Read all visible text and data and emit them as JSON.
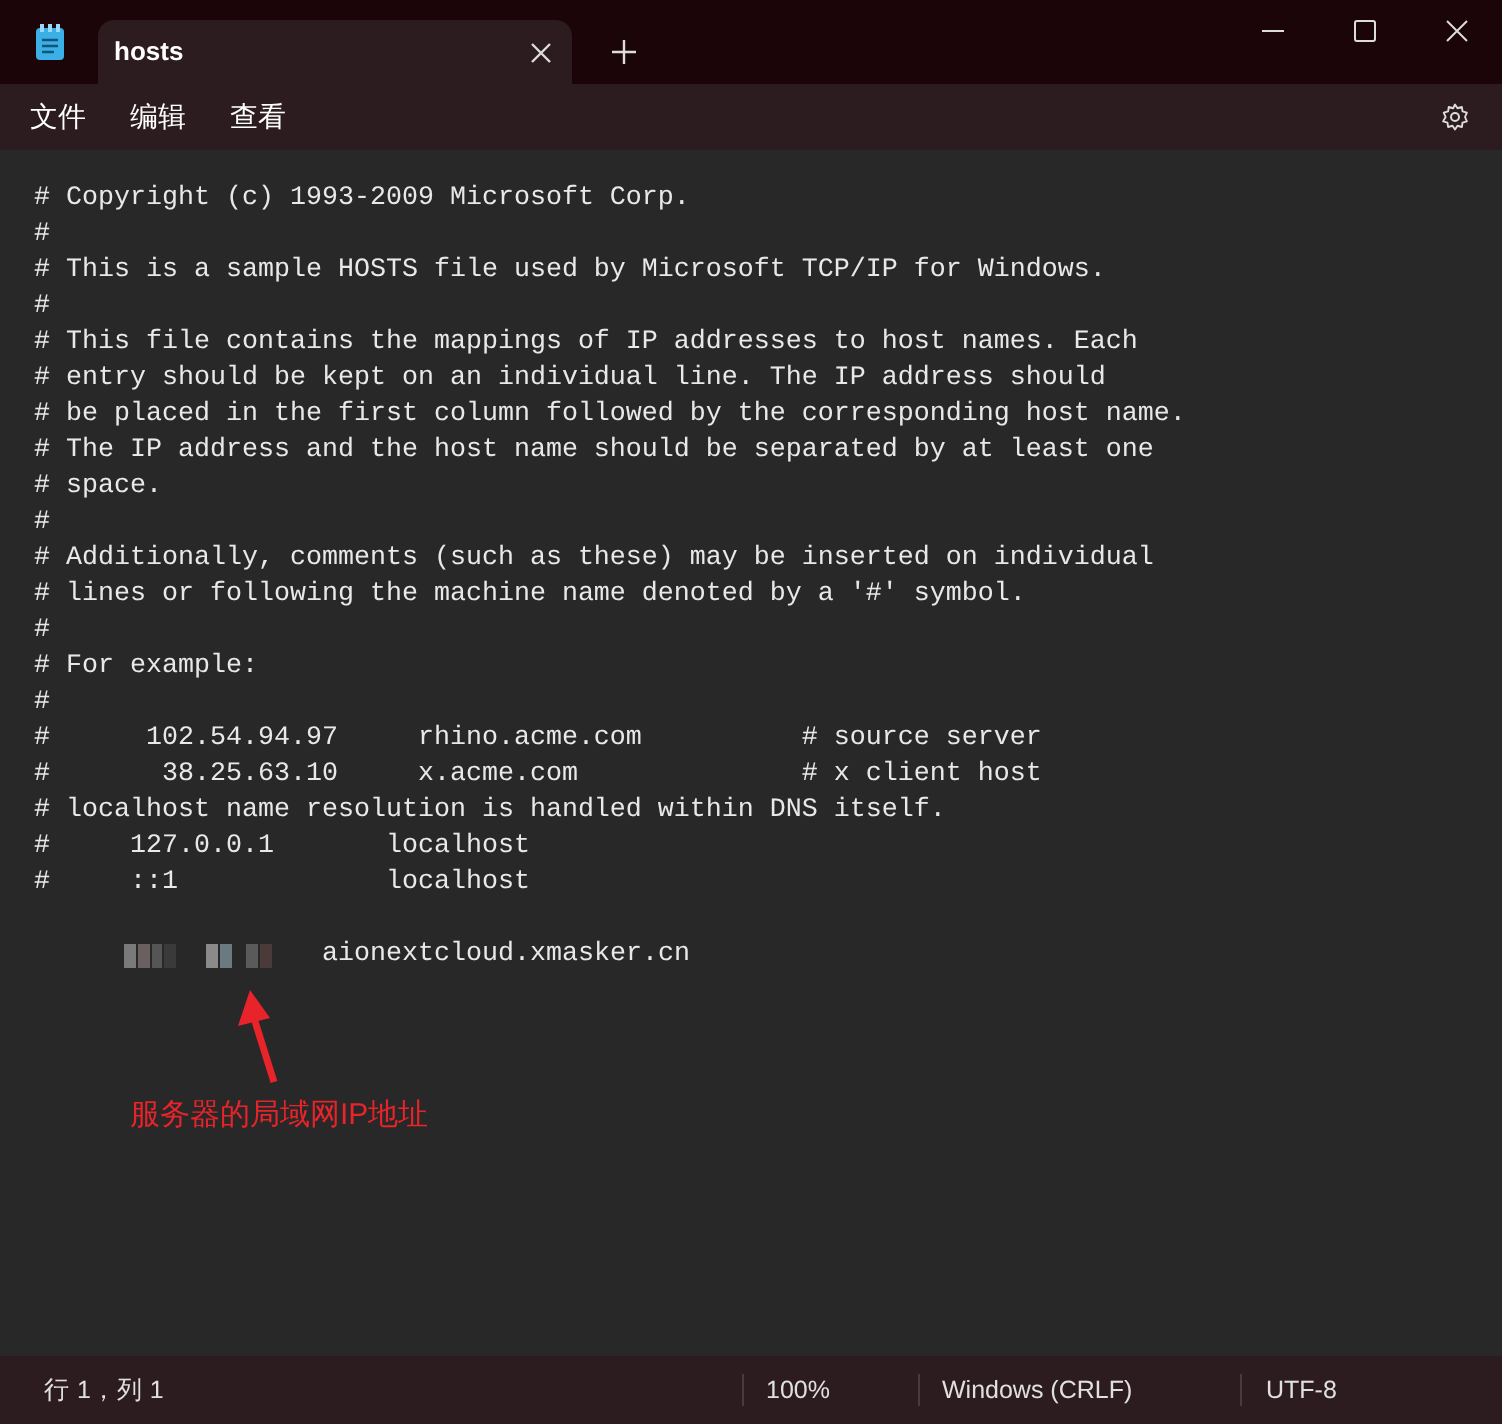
{
  "window": {
    "tab_title": "hosts"
  },
  "menu": [
    "文件",
    "编辑",
    "查看"
  ],
  "lines": [
    "# Copyright (c) 1993-2009 Microsoft Corp.",
    "#",
    "# This is a sample HOSTS file used by Microsoft TCP/IP for Windows.",
    "#",
    "# This file contains the mappings of IP addresses to host names. Each",
    "# entry should be kept on an individual line. The IP address should",
    "# be placed in the first column followed by the corresponding host name.",
    "# The IP address and the host name should be separated by at least one",
    "# space.",
    "#",
    "# Additionally, comments (such as these) may be inserted on individual",
    "# lines or following the machine name denoted by a '#' symbol.",
    "#",
    "# For example:",
    "#",
    "#      102.54.94.97     rhino.acme.com          # source server",
    "#       38.25.63.10     x.acme.com              # x client host",
    "# localhost name resolution is handled within DNS itself.",
    "#     127.0.0.1       localhost",
    "#     ::1             localhost"
  ],
  "entry": {
    "host": "aionextcloud.xmasker.cn"
  },
  "annotation": {
    "text": "服务器的局域网IP地址"
  },
  "status_bar": {
    "position": "行 1，列 1",
    "zoom": "100%",
    "line_ending": "Windows (CRLF)",
    "encoding": "UTF-8"
  }
}
